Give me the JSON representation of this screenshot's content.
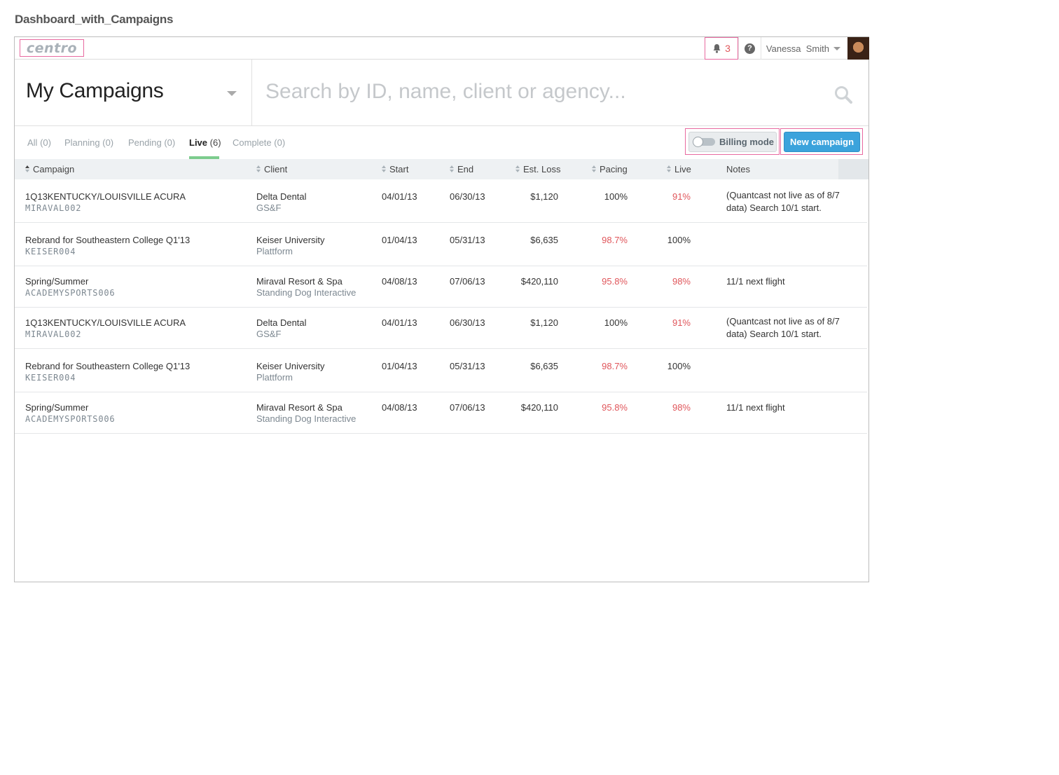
{
  "page_title": "Dashboard_with_Campaigns",
  "topbar": {
    "logo_text": "centro",
    "notifications_count": "3",
    "help_label": "?",
    "user_name": "Vanessa  Smith"
  },
  "header": {
    "selector_title": "My Campaigns",
    "search_placeholder": "Search by ID, name, client or agency..."
  },
  "tabs": [
    {
      "label": "All",
      "count": "(0)"
    },
    {
      "label": "Planning",
      "count": "(0)"
    },
    {
      "label": "Pending",
      "count": "(0)"
    },
    {
      "label": "Live",
      "count": "(6)"
    },
    {
      "label": "Complete",
      "count": "(0)"
    }
  ],
  "actions": {
    "billing_label": "Billing mode",
    "new_campaign_label": "New campaign"
  },
  "columns": {
    "campaign": "Campaign",
    "client": "Client",
    "start": "Start",
    "end": "End",
    "est_loss": "Est. Loss",
    "pacing": "Pacing",
    "live": "Live",
    "notes": "Notes"
  },
  "rows": [
    {
      "name": "1Q13KENTUCKY/LOUISVILLE ACURA",
      "id": "MIRAVAL002",
      "client": "Delta Dental",
      "agency": "GS&F",
      "start": "04/01/13",
      "end": "06/30/13",
      "est_loss": "$1,120",
      "pacing": "100%",
      "live": "91%",
      "notes": "(Quantcast not live as of 8/7 data) Search 10/1 start."
    },
    {
      "name": "Rebrand for Southeastern College Q1'13",
      "id": "KEISER004",
      "client": "Keiser University",
      "agency": "Plattform",
      "start": "01/04/13",
      "end": "05/31/13",
      "est_loss": "$6,635",
      "pacing": "98.7%",
      "live": "100%",
      "notes": ""
    },
    {
      "name": "Spring/Summer",
      "id": "ACADEMYSPORTS006",
      "client": "Miraval Resort & Spa",
      "agency": "Standing Dog Interactive",
      "start": "04/08/13",
      "end": "07/06/13",
      "est_loss": "$420,110",
      "pacing": "95.8%",
      "live": "98%",
      "notes": "11/1 next flight"
    },
    {
      "name": "1Q13KENTUCKY/LOUISVILLE ACURA",
      "id": "MIRAVAL002",
      "client": "Delta Dental",
      "agency": "GS&F",
      "start": "04/01/13",
      "end": "06/30/13",
      "est_loss": "$1,120",
      "pacing": "100%",
      "live": "91%",
      "notes": "(Quantcast not live as of 8/7 data) Search 10/1 start."
    },
    {
      "name": "Rebrand for Southeastern College Q1'13",
      "id": "KEISER004",
      "client": "Keiser University",
      "agency": "Plattform",
      "start": "01/04/13",
      "end": "05/31/13",
      "est_loss": "$6,635",
      "pacing": "98.7%",
      "live": "100%",
      "notes": ""
    },
    {
      "name": "Spring/Summer",
      "id": "ACADEMYSPORTS006",
      "client": "Miraval Resort & Spa",
      "agency": "Standing Dog Interactive",
      "start": "04/08/13",
      "end": "07/06/13",
      "est_loss": "$420,110",
      "pacing": "95.8%",
      "live": "98%",
      "notes": "11/1 next flight"
    }
  ],
  "colors": {
    "accent_blue": "#3ba3dc",
    "alert_red": "#e0565b",
    "active_tab_green": "#7ccc8d",
    "annotation_pink": "#e86aa0"
  }
}
